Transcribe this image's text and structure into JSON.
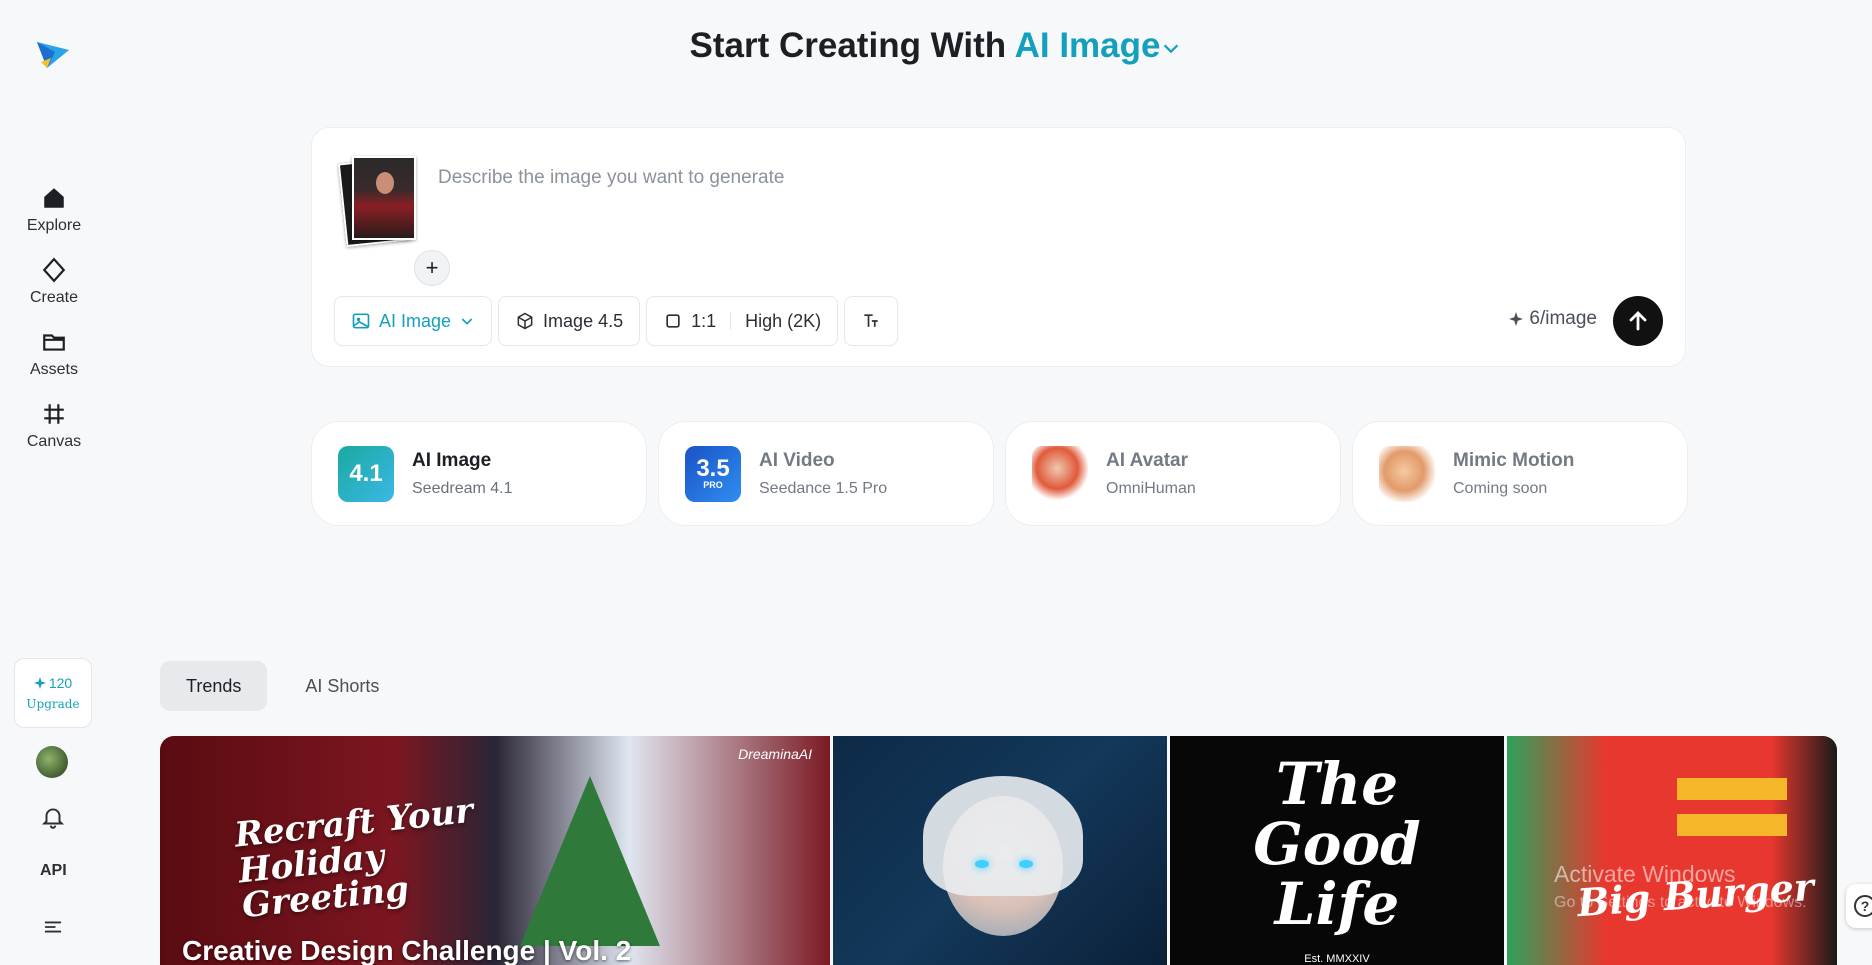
{
  "header": {
    "prefix": "Start Creating With",
    "mode": "AI Image"
  },
  "sidebar": {
    "items": [
      {
        "label": "Explore",
        "icon": "home-icon"
      },
      {
        "label": "Create",
        "icon": "diamond-icon"
      },
      {
        "label": "Assets",
        "icon": "folder-icon"
      },
      {
        "label": "Canvas",
        "icon": "frame-icon"
      }
    ],
    "credits": "120",
    "upgrade": "Upgrade",
    "api": "API"
  },
  "prompt": {
    "placeholder": "Describe the image you want to generate",
    "add_symbol": "+",
    "toolbar": {
      "mode": "AI Image",
      "model": "Image 4.5",
      "ratio": "1:1",
      "quality": "High (2K)"
    },
    "cost": "6/image"
  },
  "modes": [
    {
      "title": "AI Image",
      "sub": "Seedream 4.1",
      "badge": "4.1",
      "color": "#1fa3b8"
    },
    {
      "title": "AI Video",
      "sub": "Seedance 1.5 Pro",
      "badge": "3.5",
      "badge_sub": "PRO",
      "color": "#1f5fd6"
    },
    {
      "title": "AI Avatar",
      "sub": "OmniHuman",
      "color": "#e05a3a"
    },
    {
      "title": "Mimic Motion",
      "sub": "Coming soon",
      "color": "#e29a6a"
    }
  ],
  "tabs": [
    "Trends",
    "AI Shorts"
  ],
  "gallery": {
    "card1_script": "Recraft Your\nHoliday\nGreeting",
    "card1_brand": "DreaminaAI",
    "card1_caption": "Creative Design Challenge | Vol. 2",
    "card3_text": "The\nGood\nLife",
    "card3_est": "Est. MMXXIV",
    "card4_text": "Big Burger"
  },
  "overlay": {
    "watermark_title": "Activate Windows",
    "watermark_sub": "Go to Settings to activate Windows."
  },
  "colors": {
    "accent": "#14a0bd",
    "background": "#f7f8fa"
  }
}
